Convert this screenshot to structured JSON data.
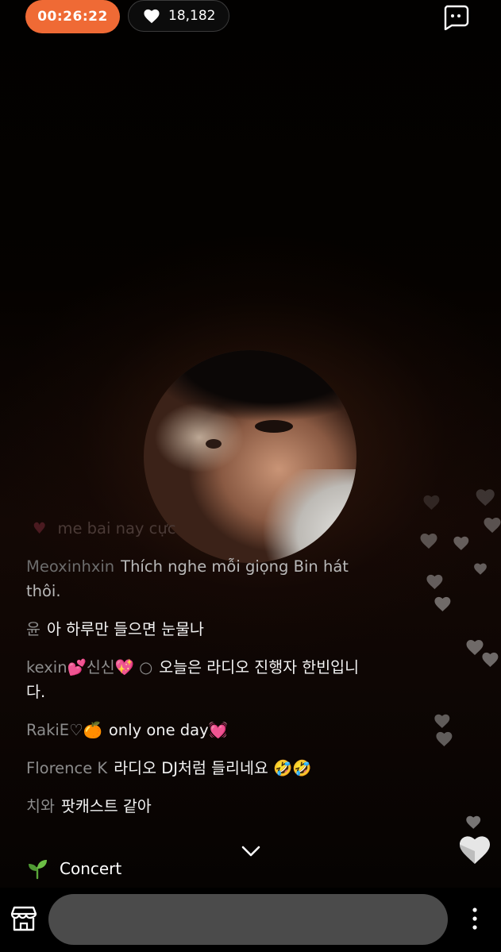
{
  "header": {
    "timer": "00:26:22",
    "likes_count": "18,182"
  },
  "comments": [
    {
      "user": "",
      "message": "me bai nay cực",
      "state": "faded"
    },
    {
      "user": "Meoxinhxin",
      "message": "Thích nghe mỗi giọng Bin hát thôi.",
      "state": "fade2"
    },
    {
      "user": "윤",
      "message": "아 하루만 들으면 눈물나",
      "state": "normal"
    },
    {
      "user": "kexin💕신신💖 ○",
      "message": "오늘은 라디오 진행자 한빈입니다.",
      "state": "normal"
    },
    {
      "user": "RakiE♡🍊",
      "message": "only one day💓",
      "state": "normal"
    },
    {
      "user": "Florence K",
      "message": "라디오 DJ처럼 들리네요 🤣🤣",
      "state": "normal"
    },
    {
      "user": "치와",
      "message": "팟캐스트 같아",
      "state": "normal"
    }
  ],
  "concert_label": "Concert",
  "icons": {
    "like": "heart-icon",
    "chat": "chat-bubble-icon",
    "concert": "sprout-icon",
    "scroll": "chevron-down-icon",
    "store": "store-icon",
    "more": "more-vertical-icon"
  },
  "colors": {
    "timer_bg": "#ef6a35",
    "input_bg": "#4b4b4b"
  }
}
